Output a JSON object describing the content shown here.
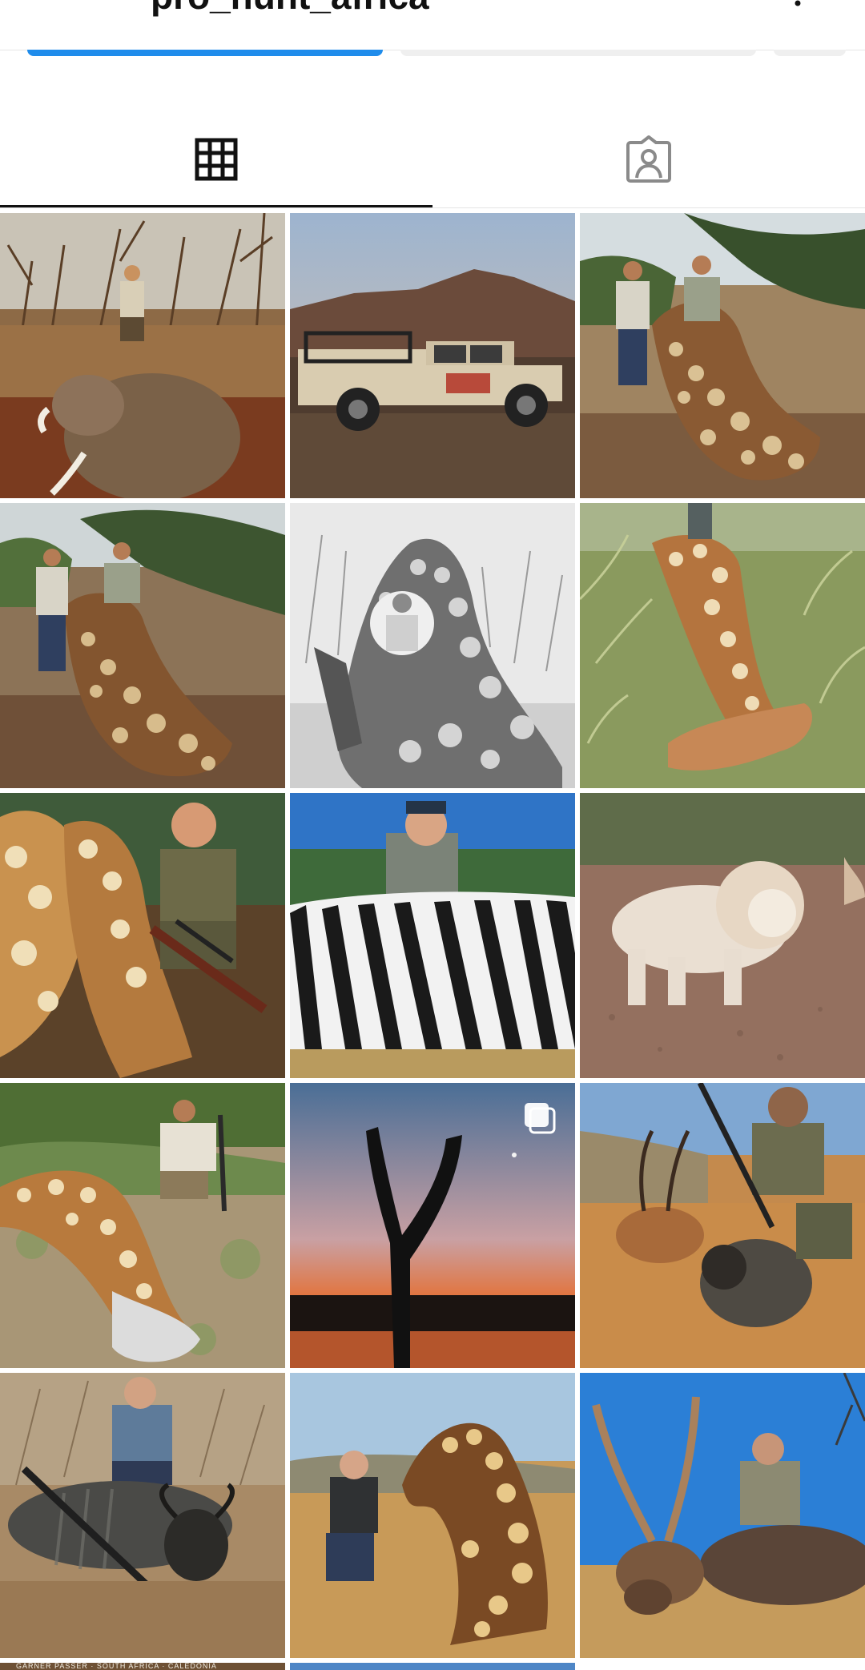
{
  "header": {
    "username": "pro_hunt_africa",
    "back_icon": "arrow-left-icon",
    "menu_icon": "more-vertical-icon"
  },
  "colors": {
    "accent": "#1f8ceb",
    "text": "#111111",
    "divider": "#e4e4e4",
    "icon_inactive": "#8a8a8a"
  },
  "tabs": [
    {
      "name": "posts-grid",
      "icon": "grid-icon",
      "active": true
    },
    {
      "name": "tagged",
      "icon": "tagged-person-icon",
      "active": false
    }
  ],
  "grid": {
    "posts": [
      {
        "subject": "hunter with elephant",
        "multiple": false
      },
      {
        "subject": "safari pickup truck",
        "multiple": false
      },
      {
        "subject": "two hunters with giraffe",
        "multiple": false
      },
      {
        "subject": "two hunters with giraffe",
        "multiple": false
      },
      {
        "subject": "hunter with giraffe black and white",
        "multiple": false
      },
      {
        "subject": "giraffe in grass",
        "multiple": false
      },
      {
        "subject": "hunter with rifle and giraffe",
        "multiple": false
      },
      {
        "subject": "woman with zebra",
        "multiple": false
      },
      {
        "subject": "white lion",
        "multiple": false
      },
      {
        "subject": "hunter with giraffe in bush",
        "multiple": false
      },
      {
        "subject": "tree silhouette at sunset",
        "multiple": true
      },
      {
        "subject": "hunter with antelope and baboon",
        "multiple": false
      },
      {
        "subject": "hunter with wildebeest",
        "multiple": false
      },
      {
        "subject": "hunter with giraffe",
        "multiple": false
      },
      {
        "subject": "hunter with waterbuck",
        "multiple": false
      }
    ],
    "peek_caption": "GARNER PASSER · SOUTH AFRICA · CALEDONIA"
  }
}
